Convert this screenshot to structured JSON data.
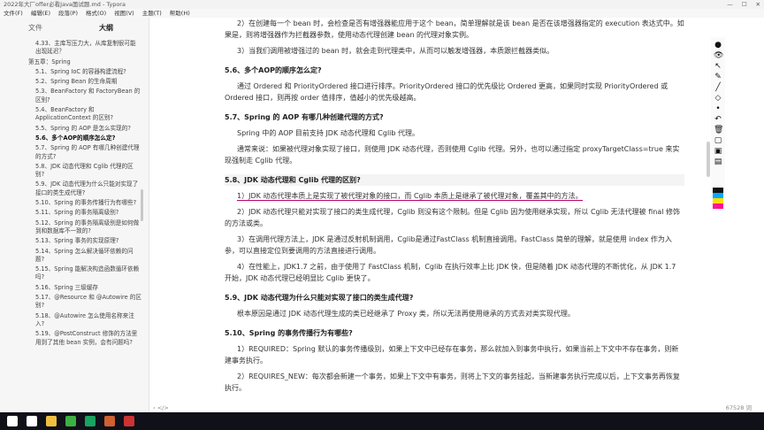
{
  "window": {
    "title": "2022年大厂offer必看Java面试题.md - Typora",
    "controls": [
      "—",
      "☐",
      "✕"
    ]
  },
  "menubar": [
    "文件(F)",
    "编辑(E)",
    "段落(P)",
    "格式(O)",
    "视图(V)",
    "主题(T)",
    "帮助(H)"
  ],
  "sidebar": {
    "tabs": [
      {
        "label": "文件",
        "active": false
      },
      {
        "label": "大纲",
        "active": true
      }
    ],
    "outline": [
      {
        "label": "4.33、主库写压力大，从库复制很可能出现延迟？",
        "level": "h3"
      },
      {
        "label": "第五章：Spring",
        "level": "h2"
      },
      {
        "label": "5.1、Spring IoC 的容器构建流程?",
        "level": "h3"
      },
      {
        "label": "5.2、Spring Bean 的生命周期",
        "level": "h3"
      },
      {
        "label": "5.3、BeanFactory 和 FactoryBean 的区别?",
        "level": "h3"
      },
      {
        "label": "5.4、BeanFactory 和 ApplicationContext 的区别?",
        "level": "h3"
      },
      {
        "label": "5.5、Spring 的 AOP 是怎么实现的?",
        "level": "h3"
      },
      {
        "label": "5.6、多个AOP的顺序怎么定?",
        "level": "h3",
        "active": true
      },
      {
        "label": "5.7、Spring 的 AOP 有哪几种创建代理的方式?",
        "level": "h3"
      },
      {
        "label": "5.8、JDK 动态代理和 Cglib 代理的区别?",
        "level": "h3"
      },
      {
        "label": "5.9、JDK 动态代理为什么只能对实现了接口的类生成代理?",
        "level": "h3"
      },
      {
        "label": "5.10、Spring 的事务传播行为有哪些?",
        "level": "h3"
      },
      {
        "label": "5.11、Spring 的事务隔离级别?",
        "level": "h3"
      },
      {
        "label": "5.12、Spring 的事务隔离级别是如何做到和数据库不一致的?",
        "level": "h3"
      },
      {
        "label": "5.13、Spring 事务的实现原理?",
        "level": "h3"
      },
      {
        "label": "5.14、Spring 怎么解决循环依赖的问题?",
        "level": "h3"
      },
      {
        "label": "5.15、Spring 能解决构造函数循环依赖吗?",
        "level": "h3"
      },
      {
        "label": "5.16、Spring 三级缓存",
        "level": "h3"
      },
      {
        "label": "5.17、@Resource 和 @Autowire 的区别?",
        "level": "h3"
      },
      {
        "label": "5.18、@Autowire 怎么使用名称来注入?",
        "level": "h3"
      },
      {
        "label": "5.19、@PostConstruct 修饰的方法里用到了其他 bean 实例，会有问题吗?",
        "level": "h3"
      }
    ],
    "footer_icons": [
      "‹",
      "</>"
    ]
  },
  "content": [
    {
      "type": "p",
      "text": "2）在创建每一个 bean 时，会检查是否有增强器能应用于这个 bean，简单理解就是该 bean 是否在该增强器指定的 execution 表达式中。如果是，则将增强器作为拦截器参数，使用动态代理创建 bean 的代理对象实例。"
    },
    {
      "type": "p",
      "text": "3）当我们调用被增强过的 bean 时，就会走到代理类中，从而可以触发增强器，本质跟拦截器类似。"
    },
    {
      "type": "h",
      "text": "5.6、多个AOP的顺序怎么定?"
    },
    {
      "type": "p",
      "text": "通过 Ordered 和 PriorityOrdered 接口进行排序。PriorityOrdered 接口的优先级比 Ordered 更高，如果同时实现 PriorityOrdered 或 Ordered 接口，则再按 order 值排序，值越小的优先级越高。"
    },
    {
      "type": "h",
      "text": "5.7、Spring 的 AOP 有哪几种创建代理的方式?"
    },
    {
      "type": "p",
      "text": "Spring 中的 AOP 目前支持 JDK 动态代理和 Cglib 代理。"
    },
    {
      "type": "p",
      "text": "通常来说：如果被代理对象实现了接口，则使用 JDK 动态代理，否则使用 Cglib 代理。另外，也可以通过指定 proxyTargetClass=true 来实现强制走 Cglib 代理。"
    },
    {
      "type": "h",
      "text": "5.8、JDK 动态代理和 Cglib 代理的区别?",
      "current": true
    },
    {
      "type": "p",
      "text": "1）JDK 动态代理本质上是实现了被代理对象的接口，而 Cglib 本质上是继承了被代理对象，覆盖其中的方法。",
      "underline": true
    },
    {
      "type": "p",
      "text": "2）JDK 动态代理只能对实现了接口的类生成代理，Cglib 则没有这个限制。但是 Cglib 因为使用继承实现，所以 Cglib 无法代理被 final 修饰的方法或类。"
    },
    {
      "type": "p",
      "text": "3）在调用代理方法上，JDK 是通过反射机制调用，Cglib是通过FastClass 机制直接调用。FastClass 简单的理解，就是使用 index 作为入参，可以直接定位到要调用的方法直接进行调用。"
    },
    {
      "type": "p",
      "text": "4）在性能上，JDK1.7 之前，由于使用了 FastClass 机制，Cglib 在执行效率上比 JDK 快，但是随着 JDK 动态代理的不断优化，从 JDK 1.7 开始，JDK 动态代理已经明显比 Cglib 更快了。"
    },
    {
      "type": "h",
      "text": "5.9、JDK 动态代理为什么只能对实现了接口的类生成代理?"
    },
    {
      "type": "p",
      "text": "根本原因是通过 JDK 动态代理生成的类已经继承了 Proxy 类，所以无法再使用继承的方式去对类实现代理。"
    },
    {
      "type": "h",
      "text": "5.10、Spring 的事务传播行为有哪些?"
    },
    {
      "type": "p",
      "text": "1）REQUIRED：Spring 默认的事务传播级别，如果上下文中已经存在事务，那么就加入到事务中执行，如果当前上下文中不存在事务，则新建事务执行。"
    },
    {
      "type": "p",
      "text": "2）REQUIRES_NEW：每次都会新建一个事务，如果上下文中有事务，则将上下文的事务挂起，当新建事务执行完成以后，上下文事务再恢复执行。"
    }
  ],
  "status": {
    "word_count": "67528 词"
  },
  "tools": [
    "●",
    "👁",
    "↖",
    "✎",
    "╱",
    "◇",
    "•",
    "↶",
    "🗑",
    "▢",
    "▣",
    "▤"
  ],
  "swatches": [
    "#111111",
    "#00aaff",
    "#ffdd00",
    "#ff1493"
  ],
  "taskbar": {
    "apps": [
      {
        "name": "start",
        "color": "#ffffff"
      },
      {
        "name": "search",
        "color": "#ffffff"
      },
      {
        "name": "folder",
        "color": "#f0c040"
      },
      {
        "name": "chat",
        "color": "#3cb043"
      },
      {
        "name": "maps",
        "color": "#1aa260"
      },
      {
        "name": "app",
        "color": "#d06030"
      },
      {
        "name": "typora",
        "color": "#cc3333"
      }
    ]
  }
}
